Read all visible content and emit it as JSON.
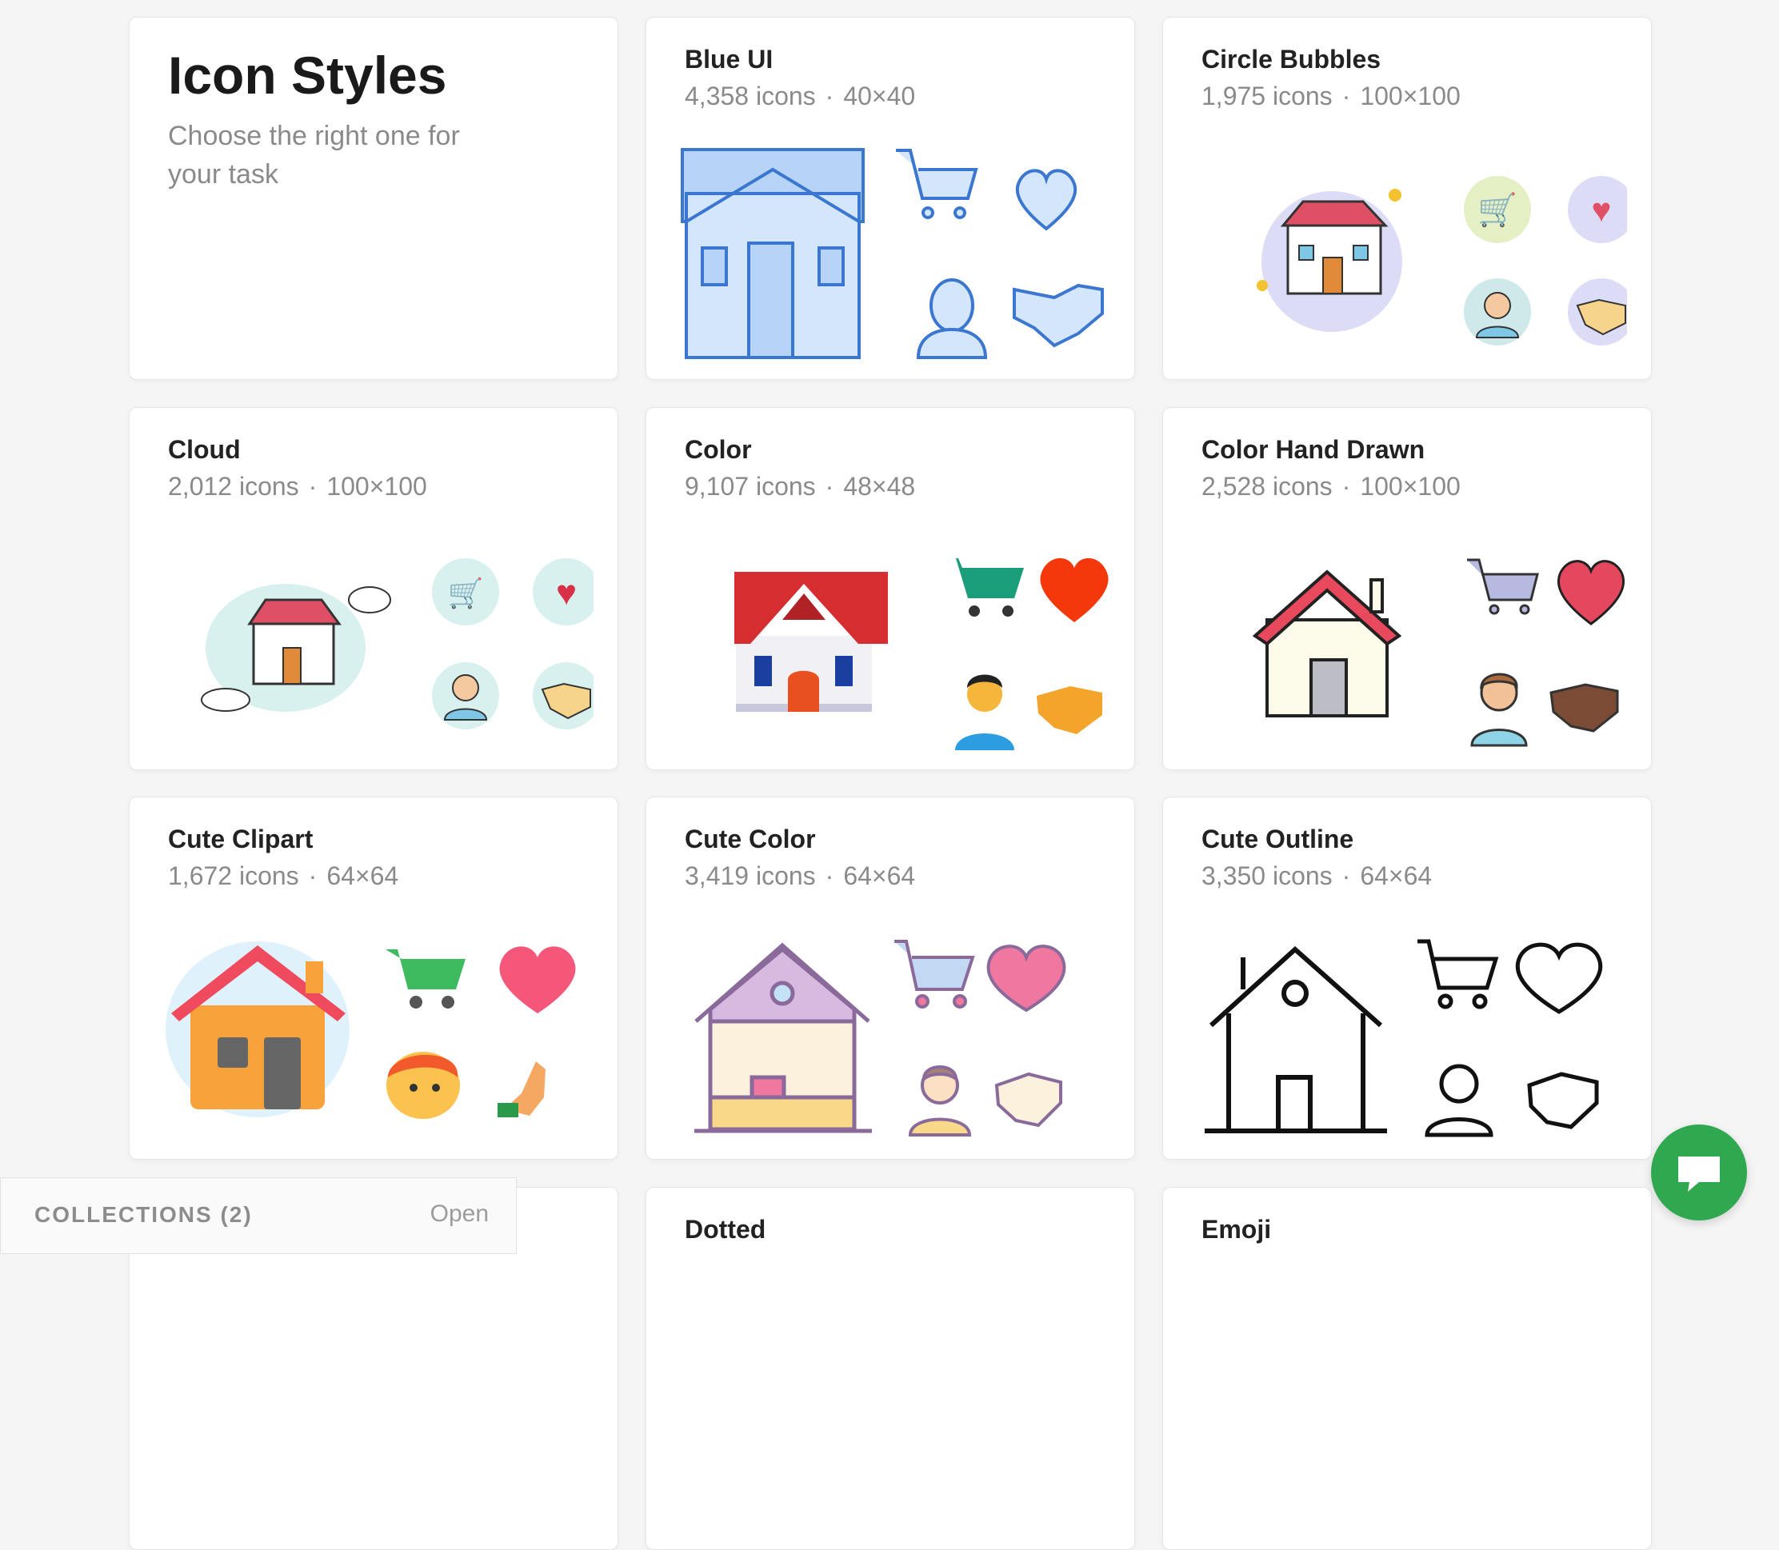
{
  "intro": {
    "title": "Icon Styles",
    "subtitle": "Choose the right one for your task"
  },
  "cards": [
    {
      "title": "Blue UI",
      "count": "4,358 icons",
      "size": "40×40"
    },
    {
      "title": "Circle Bubbles",
      "count": "1,975 icons",
      "size": "100×100"
    },
    {
      "title": "Cloud",
      "count": "2,012 icons",
      "size": "100×100"
    },
    {
      "title": "Color",
      "count": "9,107 icons",
      "size": "48×48"
    },
    {
      "title": "Color Hand Drawn",
      "count": "2,528 icons",
      "size": "100×100"
    },
    {
      "title": "Cute Clipart",
      "count": "1,672 icons",
      "size": "64×64"
    },
    {
      "title": "Cute Color",
      "count": "3,419 icons",
      "size": "64×64"
    },
    {
      "title": "Cute Outline",
      "count": "3,350 icons",
      "size": "64×64"
    },
    {
      "title": "Dotted"
    },
    {
      "title": "Emoji"
    }
  ],
  "separator": "·",
  "preview_icons": [
    "house-icon",
    "shopping-cart-icon",
    "heart-icon",
    "user-icon",
    "handshake-icon"
  ],
  "collections": {
    "label": "COLLECTIONS (2)",
    "open_label": "Open"
  },
  "chat": {
    "icon": "chat-bubble-icon",
    "color": "#2fa84f"
  }
}
